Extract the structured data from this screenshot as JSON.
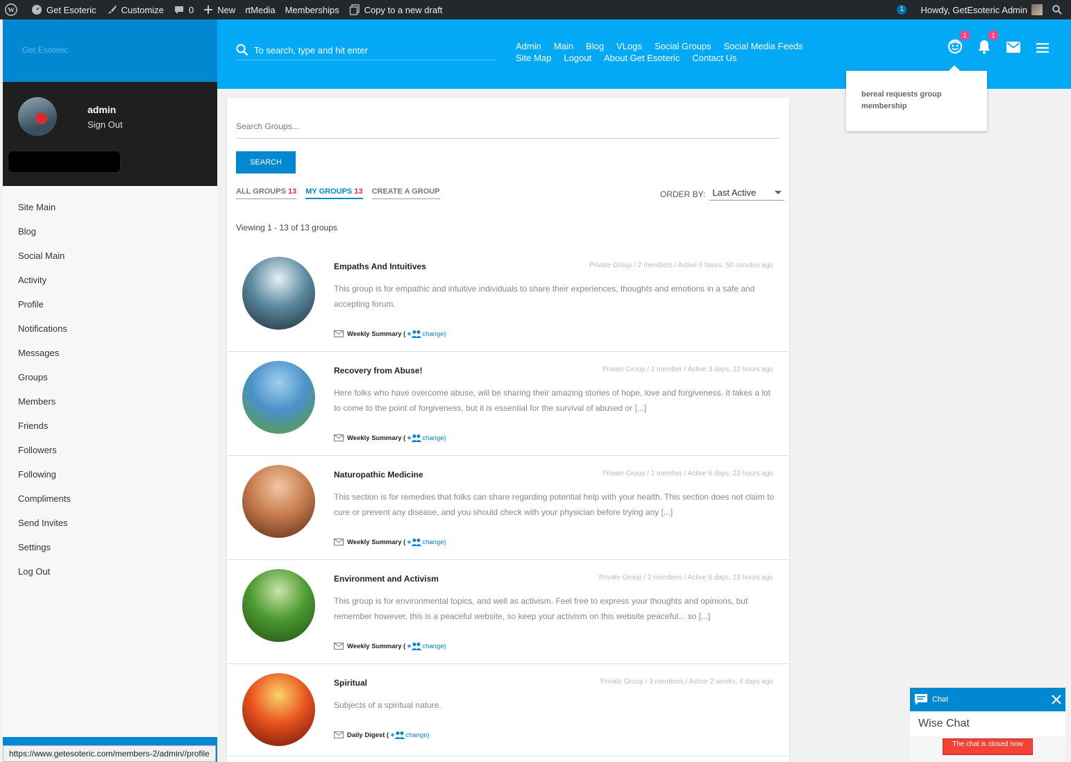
{
  "adminbar": {
    "site_name": "Get Esoteric",
    "customize": "Customize",
    "comments_count": "0",
    "new": "New",
    "rtmedia": "rtMedia",
    "memberships": "Memberships",
    "copy_draft": "Copy to a new draft",
    "updates_count": "1",
    "howdy": "Howdy, GetEsoteric Admin"
  },
  "logo": {
    "alt_text": "Get Esoteric"
  },
  "profile": {
    "name": "admin",
    "sign_out": "Sign Out"
  },
  "sidebar": {
    "items": [
      "Site Main",
      "Blog",
      "Social Main",
      "Activity",
      "Profile",
      "Notifications",
      "Messages",
      "Groups",
      "Members",
      "Friends",
      "Followers",
      "Following",
      "Compliments",
      "Send Invites",
      "Settings",
      "Log Out"
    ]
  },
  "header": {
    "search_placeholder": "To search, type and hit enter",
    "nav": [
      "Admin",
      "Main",
      "Blog",
      "VLogs",
      "Social Groups",
      "Social Media Feeds",
      "Site Map",
      "Logout",
      "About Get Esoteric",
      "Contact Us"
    ],
    "friend_badge": "1",
    "notif_badge": "1"
  },
  "notification_popup": {
    "text": "bereal requests group membership"
  },
  "groups_page": {
    "search_placeholder": "Search Groups...",
    "search_button": "SEARCH",
    "tabs": {
      "all": {
        "label": "ALL GROUPS",
        "count": "13"
      },
      "mine": {
        "label": "MY GROUPS",
        "count": "13"
      },
      "create": {
        "label": "CREATE A GROUP"
      }
    },
    "order_by_label": "ORDER BY:",
    "order_by_value": "Last Active",
    "viewing": "Viewing 1 - 13 of 13 groups",
    "change_label": "change)",
    "groups": [
      {
        "title": "Empaths And Intuitives",
        "meta": "Private Group / 2 members / Active 6 hours, 50 minutes ago",
        "desc": "This group is for empathic and intuitive individuals to share their experiences, thoughts and emotions in a safe and accepting forum.",
        "freq": "Weekly Summary (",
        "avatar_colors": [
          "#e8f1f4",
          "#5b8aa0",
          "#1d2a30"
        ]
      },
      {
        "title": "Recovery from Abuse!",
        "meta": "Private Group / 1 member / Active 3 days, 22 hours ago",
        "desc": "Here folks who have overcome abuse, will be sharing their amazing stories of hope, love and forgiveness. It takes a lot to come to the point of forgiveness, but it is essential for the survival of abused or [...]",
        "freq": "Weekly Summary (",
        "avatar_colors": [
          "#9ed0f0",
          "#4a90c8",
          "#5fa030"
        ]
      },
      {
        "title": "Naturopathic Medicine",
        "meta": "Private Group / 1 member / Active 6 days, 23 hours ago",
        "desc": "This section is for remedies that folks can share regarding potential help with your health. This section does not claim to cure or prevent any disease, and you should check with your physician before trying any [...]",
        "freq": "Weekly Summary (",
        "avatar_colors": [
          "#f1c7a3",
          "#c77d4f",
          "#5a2814"
        ]
      },
      {
        "title": "Environment and Activism",
        "meta": "Private Group / 2 members / Active 6 days, 23 hours ago",
        "desc": "This group is for environmental topics, and well as activism. Feel free to express your thoughts and opinions, but remember however, this is a peaceful website, so keep your activism on this website peaceful... so [...]",
        "freq": "Weekly Summary (",
        "avatar_colors": [
          "#c9e6a8",
          "#4e9a32",
          "#1f4d14"
        ]
      },
      {
        "title": "Spiritual",
        "meta": "Private Group / 3 members / Active 2 weeks, 4 days ago",
        "desc": "Subjects of a spiritual nature.",
        "freq": "Daily Digest (",
        "avatar_colors": [
          "#fbd36a",
          "#e8531f",
          "#6a1208"
        ]
      }
    ]
  },
  "chat": {
    "header": "Chat",
    "title": "Wise Chat",
    "closed": "The chat is closed now"
  },
  "status_url": "https://www.getesoteric.com/members-2/admin//profile",
  "colors": {
    "primary": "#03a9f4",
    "primary_dark": "#0288d1",
    "accent": "#e91e63",
    "adminbar": "#23282d"
  }
}
